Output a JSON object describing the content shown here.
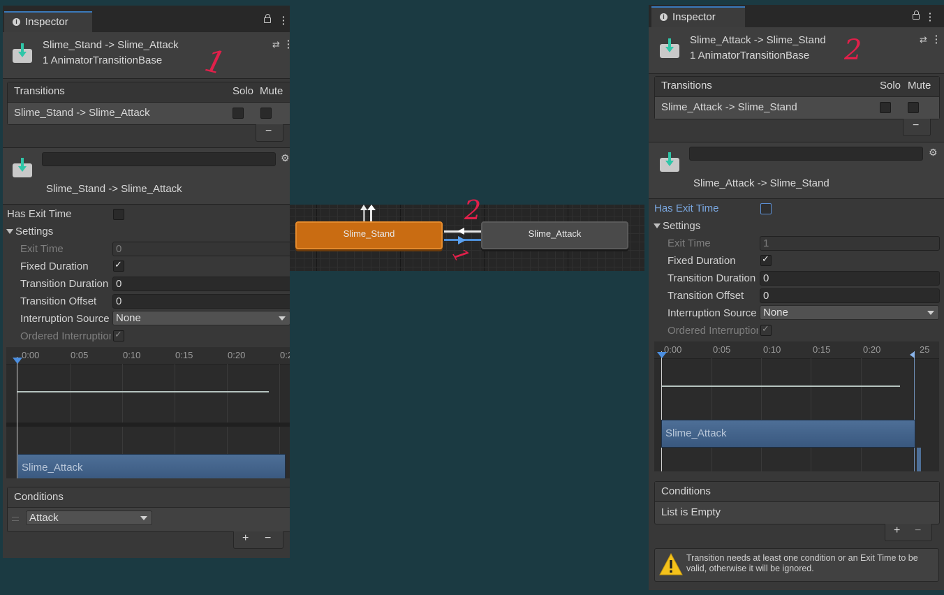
{
  "left_inspector": {
    "tab_label": "Inspector",
    "header_line1": "Slime_Stand -> Slime_Attack",
    "header_line2": "1 AnimatorTransitionBase",
    "annotation": "1",
    "transitions_header": "Transitions",
    "solo_label": "Solo",
    "mute_label": "Mute",
    "transition_row": "Slime_Stand -> Slime_Attack",
    "minus_label": "−",
    "name_field": "",
    "subtitle": "Slime_Stand -> Slime_Attack",
    "has_exit_time_label": "Has Exit Time",
    "settings_label": "Settings",
    "exit_time_label": "Exit Time",
    "exit_time_value": "0",
    "fixed_duration_label": "Fixed Duration",
    "transition_duration_label": "Transition Duration",
    "transition_duration_value": "0",
    "transition_offset_label": "Transition Offset",
    "transition_offset_value": "0",
    "interruption_source_label": "Interruption Source",
    "interruption_source_value": "None",
    "ordered_interruption_label": "Ordered Interruption",
    "ticks": [
      "0:00",
      "0:05",
      "0:10",
      "0:15",
      "0:20",
      "0:2"
    ],
    "clip_label": "Slime_Attack",
    "conditions_label": "Conditions",
    "condition_value": "Attack",
    "plus_label": "+"
  },
  "right_inspector": {
    "tab_label": "Inspector",
    "header_line1": "Slime_Attack -> Slime_Stand",
    "header_line2": "1 AnimatorTransitionBase",
    "annotation": "2",
    "transitions_header": "Transitions",
    "solo_label": "Solo",
    "mute_label": "Mute",
    "transition_row": "Slime_Attack -> Slime_Stand",
    "minus_label": "−",
    "name_field": "",
    "subtitle": "Slime_Attack -> Slime_Stand",
    "has_exit_time_label": "Has Exit Time",
    "settings_label": "Settings",
    "exit_time_label": "Exit Time",
    "exit_time_value": "1",
    "fixed_duration_label": "Fixed Duration",
    "transition_duration_label": "Transition Duration",
    "transition_duration_value": "0",
    "transition_offset_label": "Transition Offset",
    "transition_offset_value": "0",
    "interruption_source_label": "Interruption Source",
    "interruption_source_value": "None",
    "ordered_interruption_label": "Ordered Interruption",
    "ticks": [
      "0:00",
      "0:05",
      "0:10",
      "0:15",
      "0:20",
      "25"
    ],
    "clip_label": "Slime_Attack",
    "conditions_label": "Conditions",
    "conditions_empty": "List is Empty",
    "plus_label": "+",
    "warning_text": "Transition needs at least one condition or an Exit Time to be valid, otherwise it will be ignored."
  },
  "graph": {
    "node_stand": "Slime_Stand",
    "node_attack": "Slime_Attack",
    "annotation_top": "2",
    "annotation_bottom": "1"
  },
  "colors": {
    "background": "#1b3a42",
    "panel": "#383838",
    "stand_node": "#c96c12",
    "attack_node": "#4a4a4a",
    "clip_blue": "#4e6f97",
    "annotation_red": "#e0204a"
  }
}
